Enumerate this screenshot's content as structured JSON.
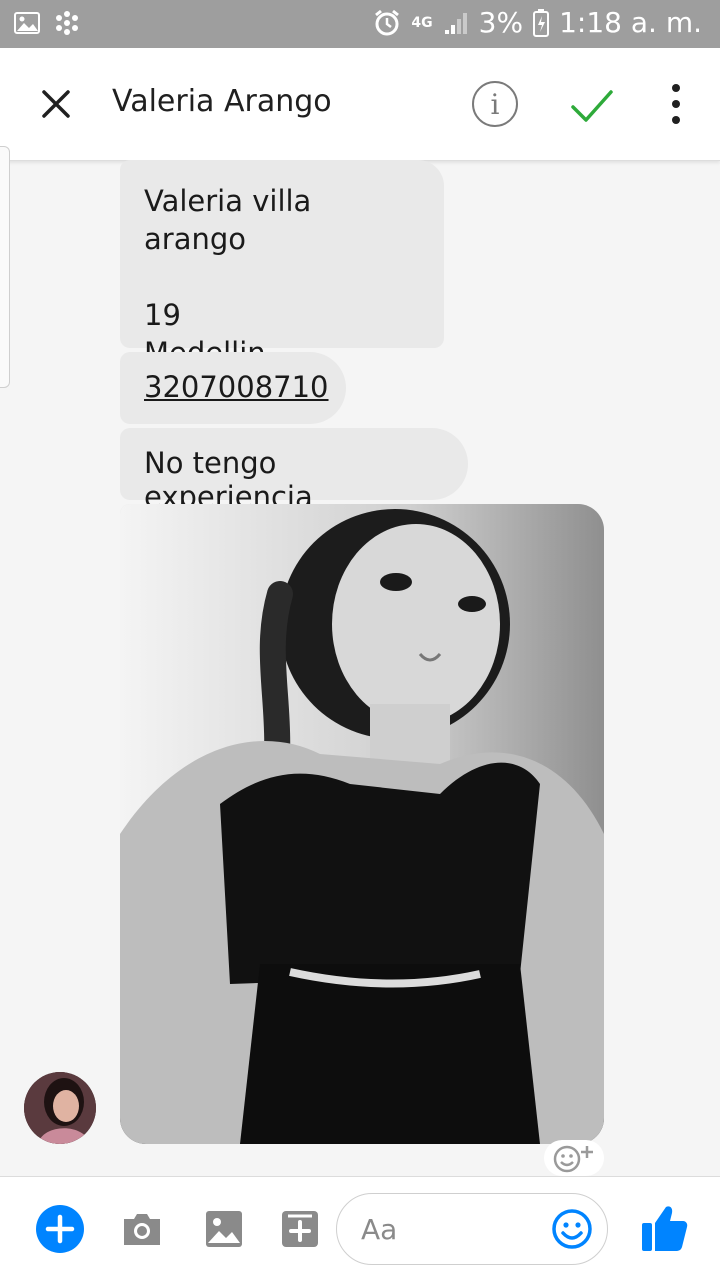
{
  "status_bar": {
    "network": "4G",
    "battery": "3%",
    "time": "1:18 a. m."
  },
  "header": {
    "title": "Valeria Arango",
    "info_glyph": "i"
  },
  "messages": [
    {
      "lines": [
        "Valeria villa arango",
        "",
        "19",
        "Medellin"
      ]
    },
    {
      "text": "3207008710"
    },
    {
      "text": "No tengo experiencia"
    }
  ],
  "composer": {
    "placeholder": "Aa"
  },
  "colors": {
    "accent": "#0084ff",
    "check": "#2eaa3a",
    "status_bar": "#9e9e9e",
    "bubble": "#e9e9e9"
  },
  "icons": {
    "close": "close-icon",
    "info": "info-icon",
    "confirm": "checkmark-icon",
    "menu": "more-vertical-icon",
    "add": "plus-icon",
    "camera": "camera-icon",
    "gallery": "image-icon",
    "sticker": "sticker-icon",
    "emoji": "emoji-icon",
    "like": "thumbs-up-icon",
    "react": "add-reaction-icon"
  }
}
